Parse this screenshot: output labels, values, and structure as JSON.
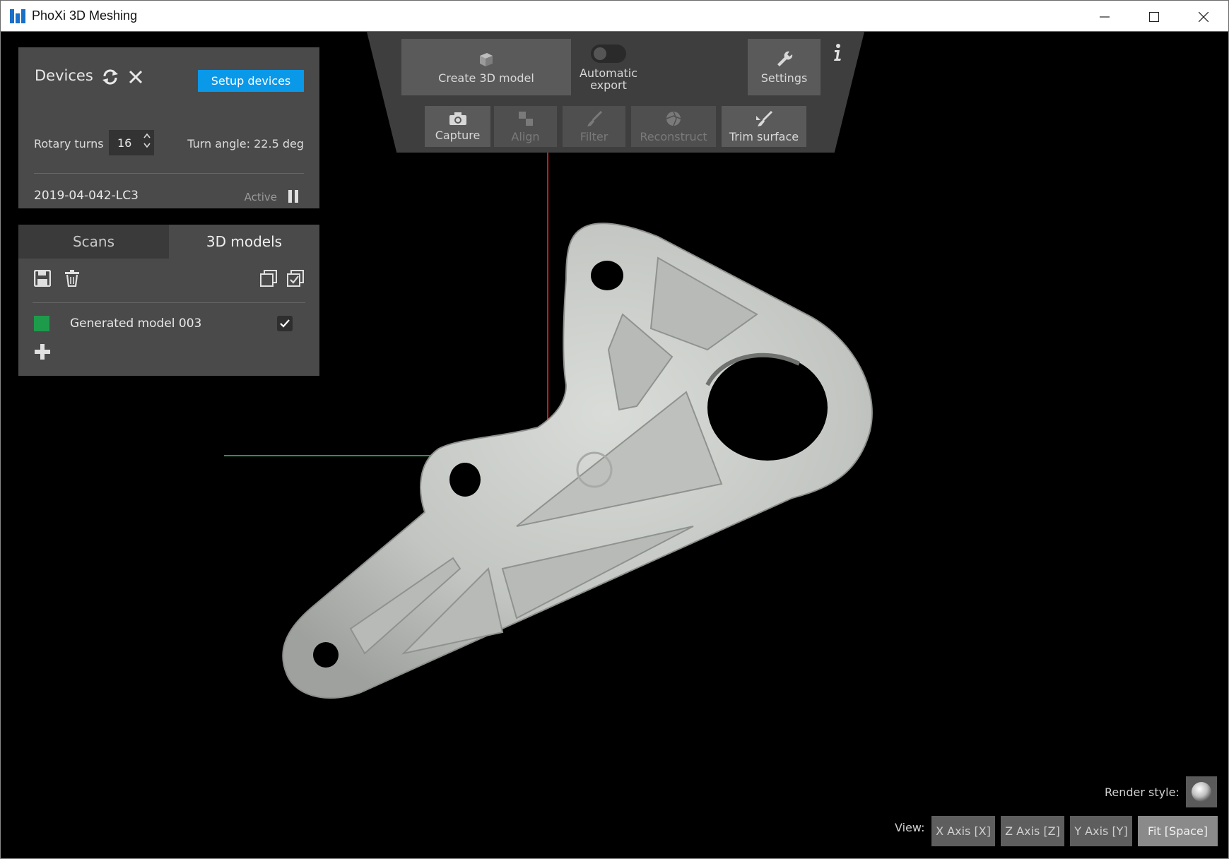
{
  "window": {
    "title": "PhoXi 3D Meshing"
  },
  "devices": {
    "title": "Devices",
    "setup_label": "Setup devices",
    "rotary_label": "Rotary turns",
    "rotary_value": "16",
    "turn_angle": "Turn angle: 22.5 deg",
    "serial": "2019-04-042-LC3",
    "status": "Active"
  },
  "models": {
    "tabs": [
      {
        "label": "Scans"
      },
      {
        "label": "3D models"
      }
    ],
    "items": [
      {
        "name": "Generated model 003",
        "color": "#1e9a4b",
        "checked": true
      }
    ]
  },
  "toolbar": {
    "create_label": "Create 3D model",
    "auto_export_label": "Automatic export",
    "settings_label": "Settings",
    "capture_label": "Capture",
    "align_label": "Align",
    "filter_label": "Filter",
    "reconstruct_label": "Reconstruct",
    "trim_label": "Trim surface"
  },
  "render": {
    "label": "Render style:"
  },
  "view": {
    "label": "View:",
    "x_label": "X Axis [X]",
    "z_label": "Z Axis [Z]",
    "y_label": "Y Axis [Y]",
    "fit_label": "Fit [Space]"
  },
  "colors": {
    "accent": "#0a98e8",
    "panel": "#4a4a4a",
    "model": "#1e9a4b"
  }
}
